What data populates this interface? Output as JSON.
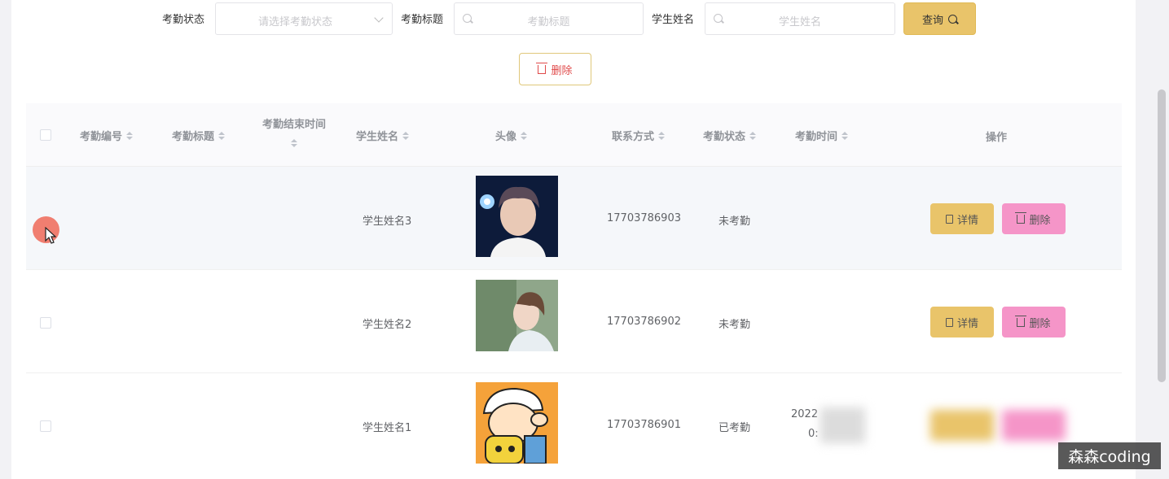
{
  "filters": {
    "status_label": "考勤状态",
    "status_placeholder": "请选择考勤状态",
    "title_label": "考勤标题",
    "title_placeholder": "考勤标题",
    "name_label": "学生姓名",
    "name_placeholder": "学生姓名",
    "query_label": "查询"
  },
  "toolbar": {
    "delete_label": "删除"
  },
  "table": {
    "columns": [
      "考勤编号",
      "考勤标题",
      "考勤结束时间",
      "学生姓名",
      "头像",
      "联系方式",
      "考勤状态",
      "考勤时间",
      "操作"
    ],
    "rows": [
      {
        "student_name": "学生姓名3",
        "phone": "17703786903",
        "status": "未考勤",
        "time": ""
      },
      {
        "student_name": "学生姓名2",
        "phone": "17703786902",
        "status": "未考勤",
        "time": ""
      },
      {
        "student_name": "学生姓名1",
        "phone": "17703786901",
        "status": "已考勤",
        "time_line1": "2022",
        "time_line2": "0:"
      }
    ],
    "detail_label": "详情",
    "delete_label": "删除"
  },
  "watermark": "森森coding",
  "colors": {
    "accent": "#e9c46a",
    "danger_btn": "#f595c8",
    "danger_text": "#e04a4a"
  },
  "icons": [
    "search-icon",
    "chevron-down-icon",
    "trash-icon",
    "document-icon",
    "sort-icon"
  ]
}
